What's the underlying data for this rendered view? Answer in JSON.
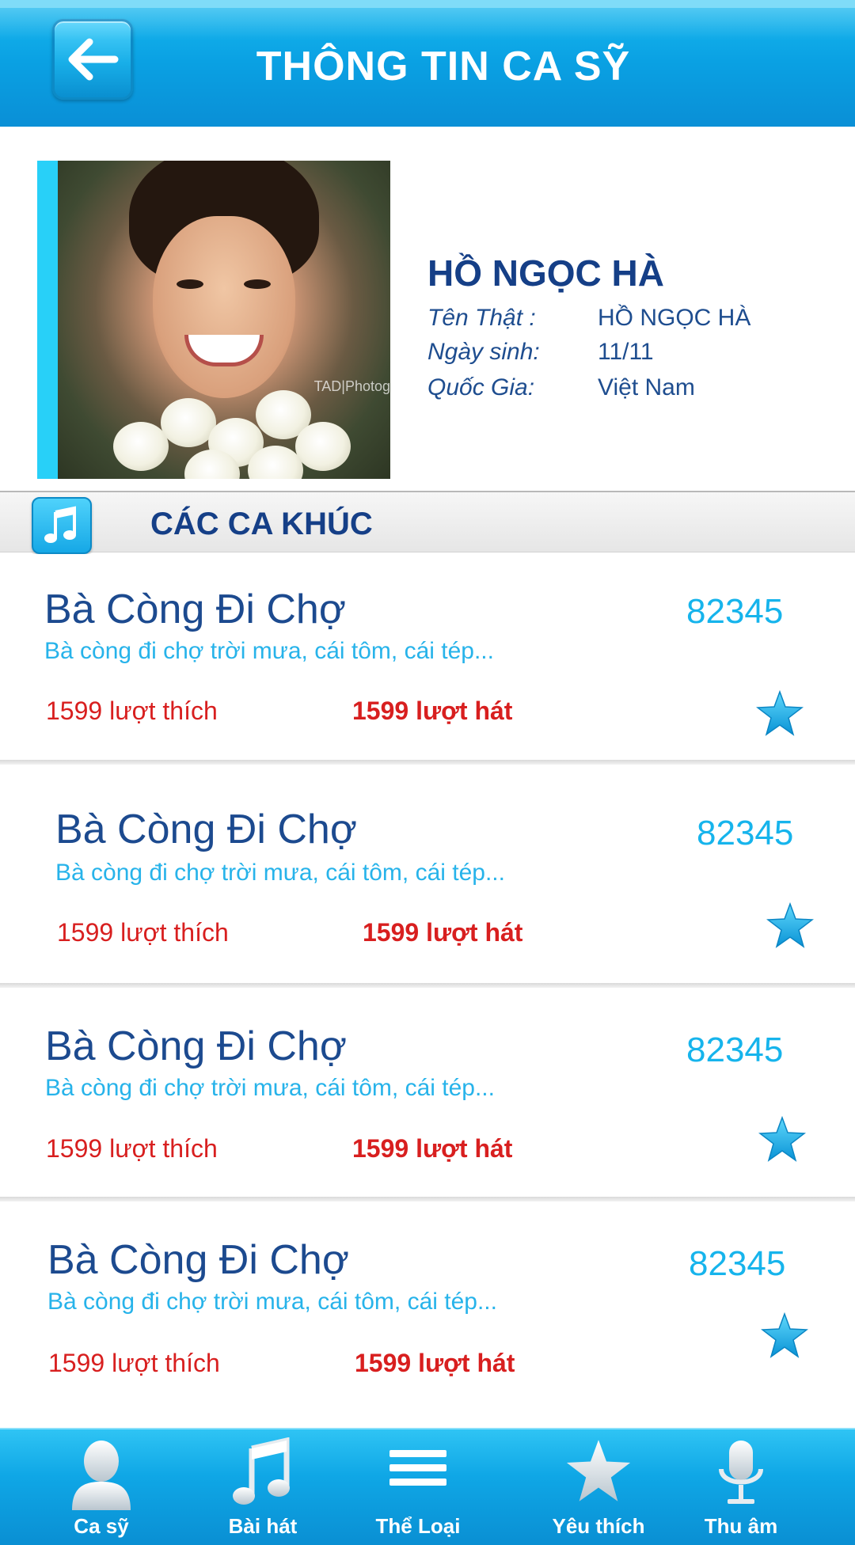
{
  "header": {
    "title": "THÔNG TIN CA  SỸ",
    "back_icon": "arrow-left-icon"
  },
  "profile": {
    "name": "HỒ NGỌC HÀ",
    "photo_caption": "TAD|Photog",
    "fields": [
      {
        "label": "Tên Thật :",
        "value": "HỒ NGỌC HÀ"
      },
      {
        "label": "Ngày sinh:",
        "value": "11/11"
      },
      {
        "label": "Quốc Gia:",
        "value": "Việt Nam"
      }
    ]
  },
  "section": {
    "title": "CÁC CA KHÚC",
    "icon": "music-note-icon"
  },
  "songs": [
    {
      "title": "Bà Còng Đi Chợ",
      "code": "82345",
      "lyric": "Bà còng đi chợ trời mưa, cái tôm, cái tép...",
      "likes": "1599 lượt thích",
      "plays": "1599 lượt hát"
    },
    {
      "title": "Bà Còng Đi Chợ",
      "code": "82345",
      "lyric": "Bà còng đi chợ trời mưa, cái tôm, cái tép...",
      "likes": "1599 lượt thích",
      "plays": "1599 lượt hát"
    },
    {
      "title": "Bà Còng Đi Chợ",
      "code": "82345",
      "lyric": "Bà còng đi chợ trời mưa, cái tôm, cái tép...",
      "likes": "1599 lượt thích",
      "plays": "1599 lượt hát"
    },
    {
      "title": "Bà Còng Đi Chợ",
      "code": "82345",
      "lyric": "Bà còng đi chợ trời mưa, cái tôm, cái tép...",
      "likes": "1599 lượt thích",
      "plays": "1599 lượt hát"
    }
  ],
  "bottom_nav": [
    {
      "label": "Ca sỹ",
      "icon": "person-icon"
    },
    {
      "label": "Bài hát",
      "icon": "music-note-icon"
    },
    {
      "label": "Thể Loại",
      "icon": "menu-icon"
    },
    {
      "label": "Yêu thích",
      "icon": "star-icon"
    },
    {
      "label": "Thu âm",
      "icon": "microphone-icon"
    }
  ],
  "colors": {
    "accent": "#0aa1e3",
    "title_blue": "#153f87",
    "code_blue": "#16b4ec",
    "red": "#d81f1f"
  }
}
